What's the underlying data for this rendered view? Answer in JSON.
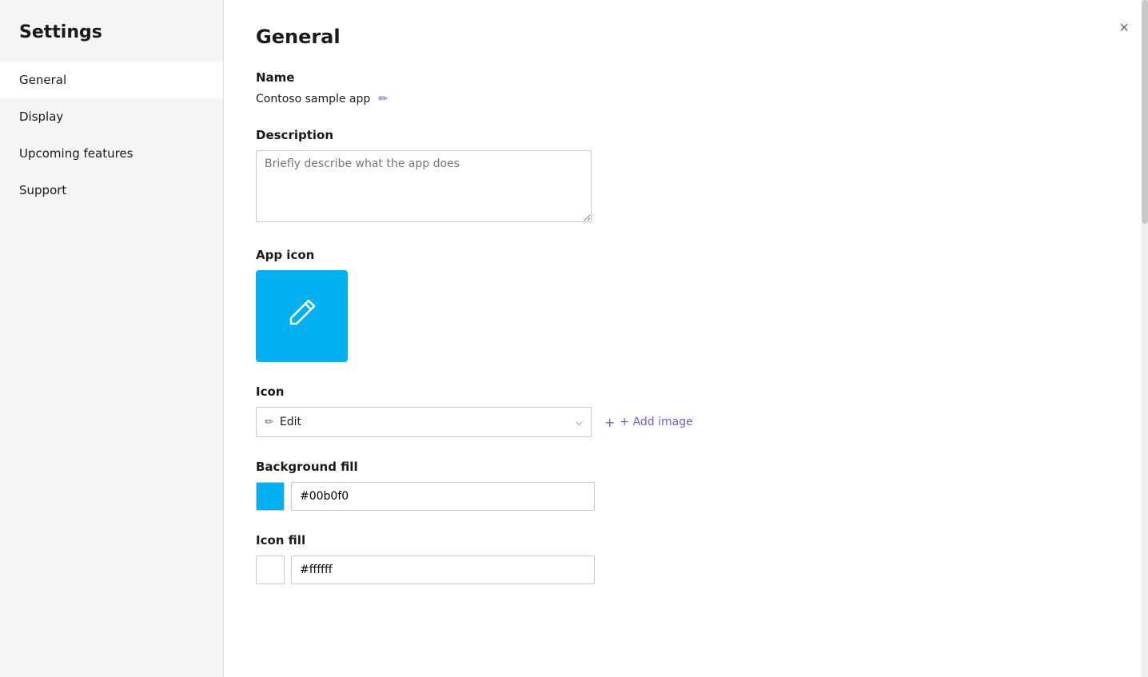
{
  "sidebar": {
    "title": "Settings",
    "nav_items": [
      {
        "id": "general",
        "label": "General",
        "active": true
      },
      {
        "id": "display",
        "label": "Display",
        "active": false
      },
      {
        "id": "upcoming-features",
        "label": "Upcoming features",
        "active": false
      },
      {
        "id": "support",
        "label": "Support",
        "active": false
      }
    ]
  },
  "main": {
    "title": "General",
    "close_button_label": "×",
    "sections": {
      "name": {
        "label": "Name",
        "value": "Contoso sample app",
        "edit_icon": "✏"
      },
      "description": {
        "label": "Description",
        "placeholder": "Briefly describe what the app does"
      },
      "app_icon": {
        "label": "App icon",
        "background_color": "#00b0f0",
        "pencil_icon": "✏"
      },
      "icon": {
        "label": "Icon",
        "selected_value": "Edit",
        "pencil_icon": "✏",
        "dropdown_arrow": "⌄",
        "add_image_label": "+ Add image"
      },
      "background_fill": {
        "label": "Background fill",
        "color": "#00b0f0",
        "value": "#00b0f0"
      },
      "icon_fill": {
        "label": "Icon fill",
        "color": "#ffffff",
        "value": "#ffffff"
      }
    }
  }
}
